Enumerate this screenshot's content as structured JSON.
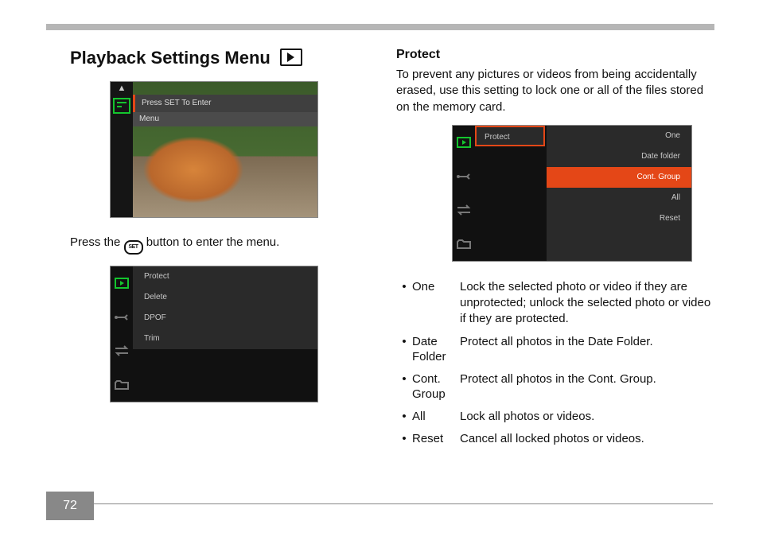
{
  "page_number": "72",
  "left": {
    "heading": "Playback Settings Menu",
    "screen1": {
      "line1": "Press SET To Enter",
      "line2": "Menu"
    },
    "instruction_pre": "Press the ",
    "set_label": "SET",
    "instruction_post": " button to enter the menu.",
    "screen2": {
      "items": [
        "Protect",
        "Delete",
        "DPOF",
        "Trim"
      ]
    }
  },
  "right": {
    "heading": "Protect",
    "intro": "To prevent any pictures or videos from being accidentally erased, use this setting to lock one or all of the files stored on the memory card.",
    "screen3": {
      "label": "Protect",
      "options": [
        "One",
        "Date folder",
        "Cont. Group",
        "All",
        "Reset"
      ],
      "selected_index": 2
    },
    "bullets": [
      {
        "term": "One",
        "def": "Lock the selected photo or video if they are unprotected; unlock the selected photo or video if they are protected."
      },
      {
        "term": "Date Folder",
        "def": "Protect all photos in the Date Folder."
      },
      {
        "term": "Cont. Group",
        "def": "Protect all photos in the Cont. Group."
      },
      {
        "term": "All",
        "def": "Lock all photos or videos."
      },
      {
        "term": "Reset",
        "def": "Cancel all locked photos or videos."
      }
    ]
  }
}
